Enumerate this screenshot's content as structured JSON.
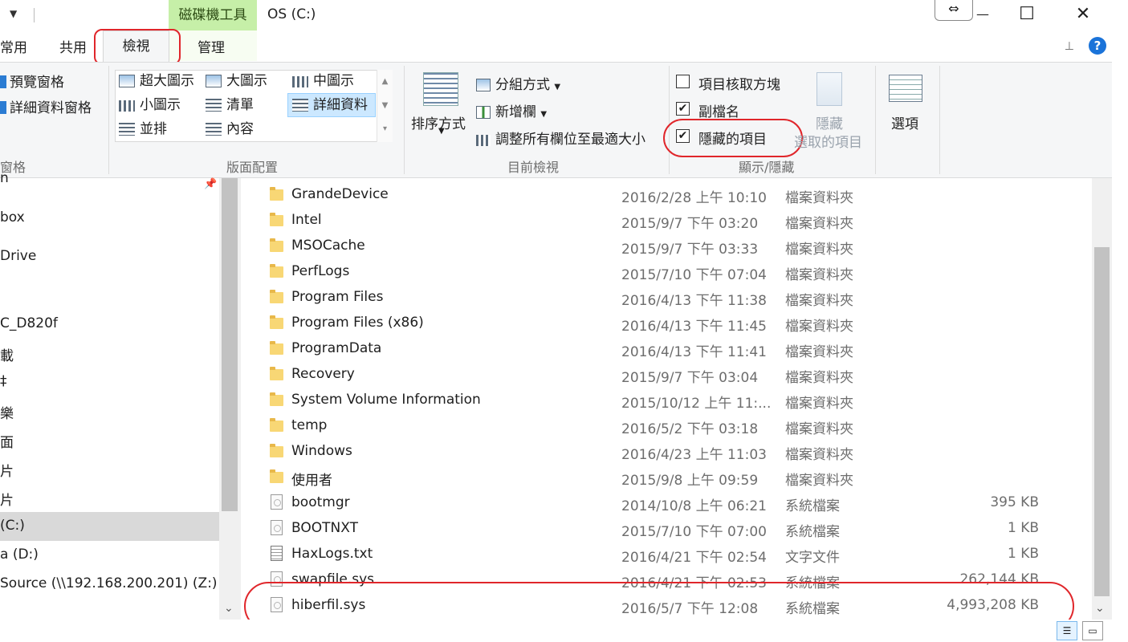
{
  "titlebar": {
    "context_tab": "磁碟機工具",
    "window_title": "OS (C:)",
    "tooltip_glyph": "⇔",
    "minimize": "—",
    "maximize": "☐",
    "close": "✕"
  },
  "tabs": {
    "home": "常用",
    "share": "共用",
    "view": "檢視",
    "manage": "管理"
  },
  "ribbon": {
    "panes": {
      "preview_pane": "預覽窗格",
      "details_pane": "詳細資料窗格",
      "group_label": "窗格"
    },
    "layout": {
      "extra_large": "超大圖示",
      "large": "大圖示",
      "medium": "中圖示",
      "small": "小圖示",
      "list": "清單",
      "details": "詳細資料",
      "tiles": "並排",
      "content": "內容",
      "group_label": "版面配置"
    },
    "current_view": {
      "sort_by": "排序方式",
      "group_by": "分組方式",
      "add_columns": "新增欄",
      "size_all_columns": "調整所有欄位至最適大小",
      "group_label": "目前檢視"
    },
    "show_hide": {
      "item_check_boxes": "項目核取方塊",
      "item_check_boxes_checked": false,
      "file_name_extensions": "副檔名",
      "file_name_extensions_checked": true,
      "hidden_items": "隱藏的項目",
      "hidden_items_checked": true,
      "hide_selected_1": "隱藏",
      "hide_selected_2": "選取的項目",
      "group_label": "顯示/隱藏"
    },
    "options": "選項"
  },
  "nav": {
    "items": [
      {
        "label": "n"
      },
      {
        "label": "box"
      },
      {
        "label": "Drive"
      },
      {
        "label": "C_D820f"
      },
      {
        "label": "載"
      },
      {
        "label": "‡"
      },
      {
        "label": "樂"
      },
      {
        "label": "面"
      },
      {
        "label": "片"
      },
      {
        "label": "片"
      },
      {
        "label": "(C:)"
      },
      {
        "label": "a (D:)"
      },
      {
        "label": "Source (\\\\192.168.200.201) (Z:)"
      }
    ]
  },
  "files": [
    {
      "name": "GrandeDevice",
      "date": "2016/2/28 上午 10:10",
      "type": "檔案資料夾",
      "size": "",
      "kind": "folder"
    },
    {
      "name": "Intel",
      "date": "2015/9/7 下午 03:20",
      "type": "檔案資料夾",
      "size": "",
      "kind": "folder"
    },
    {
      "name": "MSOCache",
      "date": "2015/9/7 下午 03:33",
      "type": "檔案資料夾",
      "size": "",
      "kind": "folder"
    },
    {
      "name": "PerfLogs",
      "date": "2015/7/10 下午 07:04",
      "type": "檔案資料夾",
      "size": "",
      "kind": "folder"
    },
    {
      "name": "Program Files",
      "date": "2016/4/13 下午 11:38",
      "type": "檔案資料夾",
      "size": "",
      "kind": "folder"
    },
    {
      "name": "Program Files (x86)",
      "date": "2016/4/13 下午 11:45",
      "type": "檔案資料夾",
      "size": "",
      "kind": "folder"
    },
    {
      "name": "ProgramData",
      "date": "2016/4/13 下午 11:41",
      "type": "檔案資料夾",
      "size": "",
      "kind": "folder"
    },
    {
      "name": "Recovery",
      "date": "2015/9/7 下午 03:04",
      "type": "檔案資料夾",
      "size": "",
      "kind": "folder"
    },
    {
      "name": "System Volume Information",
      "date": "2015/10/12 上午 11:...",
      "type": "檔案資料夾",
      "size": "",
      "kind": "folder"
    },
    {
      "name": "temp",
      "date": "2016/5/2 下午 03:18",
      "type": "檔案資料夾",
      "size": "",
      "kind": "folder"
    },
    {
      "name": "Windows",
      "date": "2016/4/23 上午 11:03",
      "type": "檔案資料夾",
      "size": "",
      "kind": "folder"
    },
    {
      "name": "使用者",
      "date": "2015/9/8 上午 09:59",
      "type": "檔案資料夾",
      "size": "",
      "kind": "folder"
    },
    {
      "name": "bootmgr",
      "date": "2014/10/8 上午 06:21",
      "type": "系統檔案",
      "size": "395 KB",
      "kind": "system"
    },
    {
      "name": "BOOTNXT",
      "date": "2015/7/10 下午 07:00",
      "type": "系統檔案",
      "size": "1 KB",
      "kind": "system"
    },
    {
      "name": "HaxLogs.txt",
      "date": "2016/4/21 下午 02:54",
      "type": "文字文件",
      "size": "1 KB",
      "kind": "text"
    },
    {
      "name": "swapfile.sys",
      "date": "2016/4/21 下午 02:53",
      "type": "系統檔案",
      "size": "262,144 KB",
      "kind": "system"
    },
    {
      "name": "hiberfil.sys",
      "date": "2016/5/7 下午 12:08",
      "type": "系統檔案",
      "size": "4,993,208 KB",
      "kind": "system"
    }
  ],
  "colors": {
    "highlight": "#e0262b",
    "context_tab": "#c6efa8",
    "selection": "#cce8ff"
  }
}
